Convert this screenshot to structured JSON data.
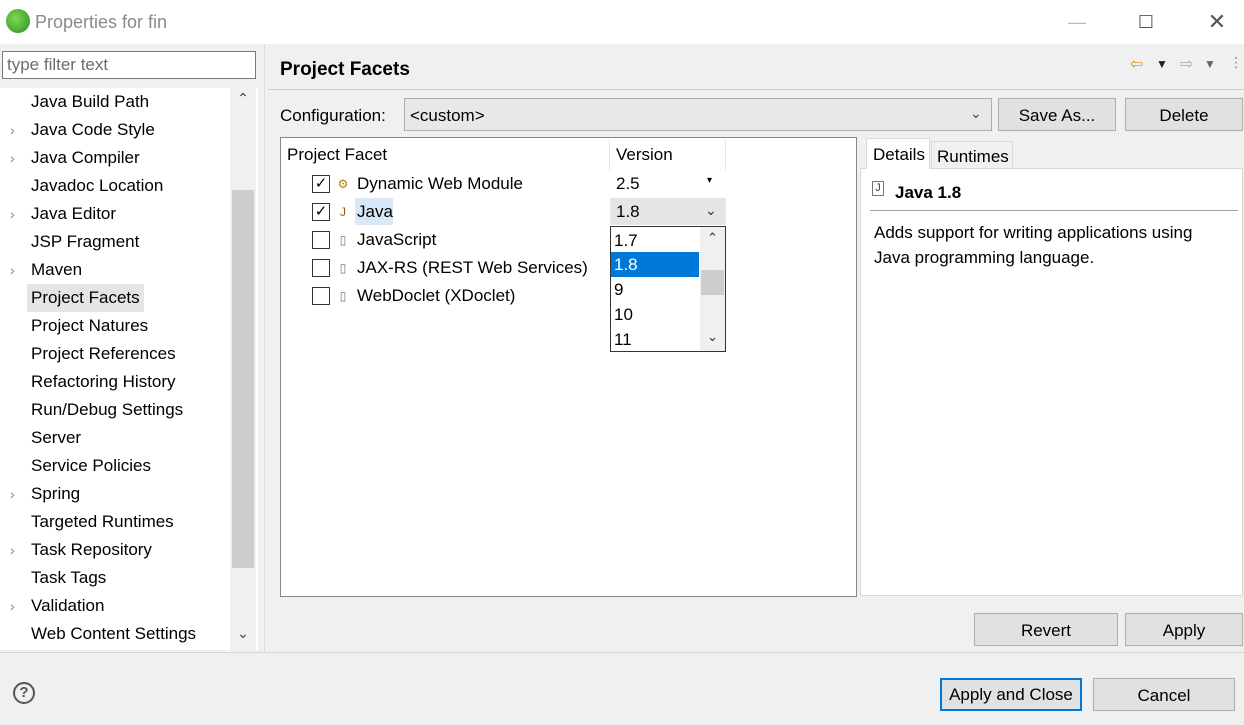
{
  "window": {
    "title": "Properties for fin",
    "min": "—",
    "max": "☐",
    "close": "✕"
  },
  "filter": {
    "placeholder": "type filter text"
  },
  "tree": {
    "up": "⌃",
    "down": "⌄",
    "items": [
      {
        "label": "Java Build Path",
        "chevron": ""
      },
      {
        "label": "Java Code Style",
        "chevron": "›"
      },
      {
        "label": "Java Compiler",
        "chevron": "›"
      },
      {
        "label": "Javadoc Location",
        "chevron": ""
      },
      {
        "label": "Java Editor",
        "chevron": "›"
      },
      {
        "label": "JSP Fragment",
        "chevron": ""
      },
      {
        "label": "Maven",
        "chevron": "›"
      },
      {
        "label": "Project Facets",
        "chevron": "",
        "selected": true
      },
      {
        "label": "Project Natures",
        "chevron": ""
      },
      {
        "label": "Project References",
        "chevron": ""
      },
      {
        "label": "Refactoring History",
        "chevron": ""
      },
      {
        "label": "Run/Debug Settings",
        "chevron": ""
      },
      {
        "label": "Server",
        "chevron": ""
      },
      {
        "label": "Service Policies",
        "chevron": ""
      },
      {
        "label": "Spring",
        "chevron": "›"
      },
      {
        "label": "Targeted Runtimes",
        "chevron": ""
      },
      {
        "label": "Task Repository",
        "chevron": "›"
      },
      {
        "label": "Task Tags",
        "chevron": ""
      },
      {
        "label": "Validation",
        "chevron": "›"
      },
      {
        "label": "Web Content Settings",
        "chevron": ""
      }
    ]
  },
  "page": {
    "title": "Project Facets",
    "nav": {
      "back": "⇦",
      "menu": "▼",
      "forward": "⇨",
      "view_menu": "⋮"
    }
  },
  "config": {
    "label": "Configuration:",
    "value": "<custom>",
    "arrow": "⌄",
    "save_as": "Save As...",
    "delete": "Delete"
  },
  "facets": {
    "col_facet": "Project Facet",
    "col_version": "Version",
    "rows": [
      {
        "name": "Dynamic Web Module",
        "checked": "✓",
        "icon": "⚙",
        "version": "2.5"
      },
      {
        "name": "Java",
        "checked": "✓",
        "icon": "J",
        "version": "1.8"
      },
      {
        "name": "JavaScript",
        "checked": "",
        "icon": "▯",
        "version": ""
      },
      {
        "name": "JAX-RS (REST Web Services)",
        "checked": "",
        "icon": "▯",
        "version": ""
      },
      {
        "name": "WebDoclet (XDoclet)",
        "checked": "",
        "icon": "▯",
        "version": ""
      }
    ],
    "dwm_arrow": "▾",
    "java_arrow": "⌄"
  },
  "dropdown": {
    "items": [
      "1.7",
      "1.8",
      "9",
      "10",
      "11"
    ],
    "selected_index": 1,
    "up": "⌃",
    "down": "⌄"
  },
  "details": {
    "tab_details": "Details",
    "tab_runtimes": "Runtimes",
    "icon": "J",
    "title": "Java 1.8",
    "description": "Adds support for writing applications using Java programming language."
  },
  "buttons": {
    "revert": "Revert",
    "apply": "Apply",
    "apply_close": "Apply and Close",
    "cancel": "Cancel",
    "help": "?"
  }
}
